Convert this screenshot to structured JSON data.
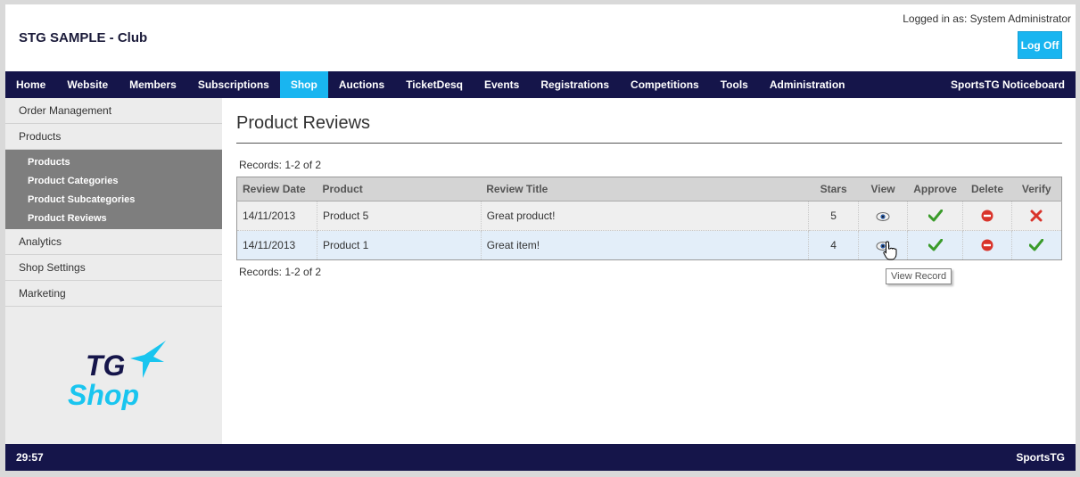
{
  "header": {
    "club_title": "STG SAMPLE - Club",
    "logged_in": "Logged in as: System Administrator",
    "logoff_label": "Log Off"
  },
  "nav": {
    "items": [
      "Home",
      "Website",
      "Members",
      "Subscriptions",
      "Shop",
      "Auctions",
      "TicketDesq",
      "Events",
      "Registrations",
      "Competitions",
      "Tools",
      "Administration"
    ],
    "active": "Shop",
    "right_label": "SportsTG Noticeboard"
  },
  "sidebar": {
    "items_top": [
      "Order Management",
      "Products"
    ],
    "sub_items": [
      "Products",
      "Product Categories",
      "Product Subcategories",
      "Product Reviews"
    ],
    "items_bottom": [
      "Analytics",
      "Shop Settings",
      "Marketing"
    ],
    "logo_top": "TG",
    "logo_bottom": "Shop"
  },
  "main": {
    "page_title": "Product Reviews",
    "records_label": "Records: 1-2 of 2",
    "columns": [
      "Review Date",
      "Product",
      "Review Title",
      "Stars",
      "View",
      "Approve",
      "Delete",
      "Verify"
    ],
    "rows": [
      {
        "date": "14/11/2013",
        "product": "Product 5",
        "title": "Great product!",
        "stars": "5",
        "verify": "unverified"
      },
      {
        "date": "14/11/2013",
        "product": "Product 1",
        "title": "Great item!",
        "stars": "4",
        "verify": "verified"
      }
    ],
    "tooltip": "View Record"
  },
  "footer": {
    "timer": "29:57",
    "brand": "SportsTG"
  },
  "colors": {
    "nav_bg": "#15154a",
    "accent": "#19b5f0",
    "check_green": "#3a9b2a",
    "delete_red": "#d9342b"
  },
  "icons": {
    "view": "eye-icon",
    "approve": "check-icon",
    "delete": "delete-circle-icon",
    "unverified": "red-x-icon",
    "verified": "check-icon"
  }
}
